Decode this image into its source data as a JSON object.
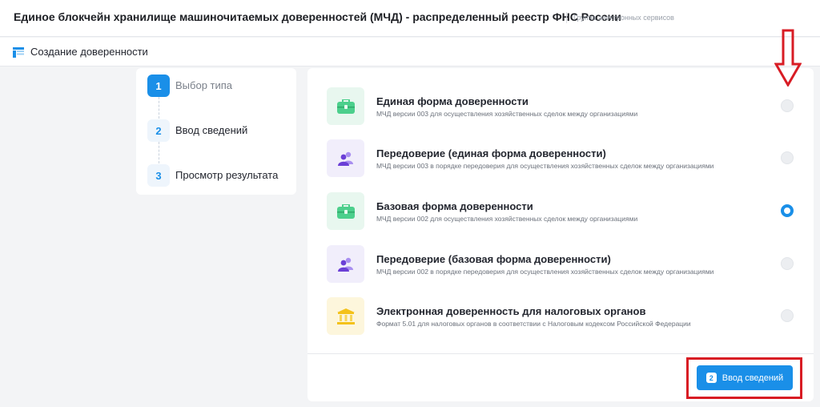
{
  "header": {
    "title": "Единое блокчейн хранилище машиночитаемых доверенностей (МЧД) - распределенный реестр ФНС России",
    "group": "Группа электронных сервисов"
  },
  "subheader": {
    "icon": "form-icon",
    "title": "Создание доверенности"
  },
  "steps": [
    {
      "num": "1",
      "label": "Выбор типа",
      "state": "active"
    },
    {
      "num": "2",
      "label": "Ввод сведений",
      "state": "pending"
    },
    {
      "num": "3",
      "label": "Просмотр результата",
      "state": "pending"
    }
  ],
  "options": [
    {
      "icon": "briefcase-icon",
      "title": "Единая форма доверенности",
      "desc": "МЧД версии 003 для осуществления хозяйственных сделок между организациями",
      "selected": false
    },
    {
      "icon": "people-icon",
      "title": "Передоверие (единая форма доверенности)",
      "desc": "МЧД версии 003 в порядке передоверия для осуществления хозяйственных сделок между организациями",
      "selected": false
    },
    {
      "icon": "briefcase-icon",
      "title": "Базовая форма доверенности",
      "desc": "МЧД версии 002 для осуществления хозяйственных сделок между организациями",
      "selected": true
    },
    {
      "icon": "people-icon",
      "title": "Передоверие (базовая форма доверенности)",
      "desc": "МЧД версии 002 в порядке передоверия для осуществления хозяйственных сделок между организациями",
      "selected": false
    },
    {
      "icon": "bank-icon",
      "title": "Электронная доверенность для налоговых органов",
      "desc": "Формат 5.01 для налоговых органов в соответствии с Налоговым кодексом Российской Федерации",
      "selected": false
    }
  ],
  "next_button": {
    "badge": "2",
    "label": "Ввод сведений"
  },
  "colors": {
    "accent": "#1a8fe8",
    "annotation": "#d81c24",
    "green_tile": "#e8f7ef",
    "purple_tile": "#f1eefb",
    "yellow_tile": "#fdf6dc"
  }
}
